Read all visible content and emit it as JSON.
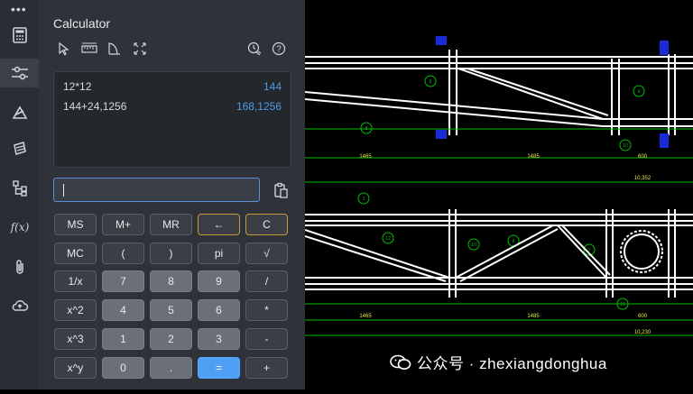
{
  "calculator": {
    "title": "Calculator",
    "history": [
      {
        "expr": "12*12",
        "result": "144"
      },
      {
        "expr": "144+24,1256",
        "result": "168,1256"
      }
    ],
    "input_value": ""
  },
  "buttons": [
    [
      "MS",
      "M+",
      "MR",
      "←",
      "C"
    ],
    [
      "MC",
      "(",
      ")",
      "pi",
      "√"
    ],
    [
      "1/x",
      "7",
      "8",
      "9",
      "/"
    ],
    [
      "x^2",
      "4",
      "5",
      "6",
      "*"
    ],
    [
      "x^3",
      "1",
      "2",
      "3",
      "-"
    ],
    [
      "x^y",
      "0",
      ".",
      "=",
      "+"
    ]
  ],
  "drawing": {
    "dims_top": [
      "1465",
      "1485",
      "600"
    ],
    "total_top": "10,352",
    "dims_bottom": [
      "1465",
      "1485",
      "600"
    ],
    "total_bottom": "10,230",
    "callouts": [
      "6",
      "6",
      "8",
      "10",
      "1",
      "12",
      "10",
      "8",
      "7",
      "11"
    ]
  },
  "watermark": {
    "text": "公众号 · zhexiangdonghua"
  },
  "colors": {
    "accent": "#4ea0f5",
    "warn": "#c99a3a",
    "result": "#4e9be6"
  }
}
